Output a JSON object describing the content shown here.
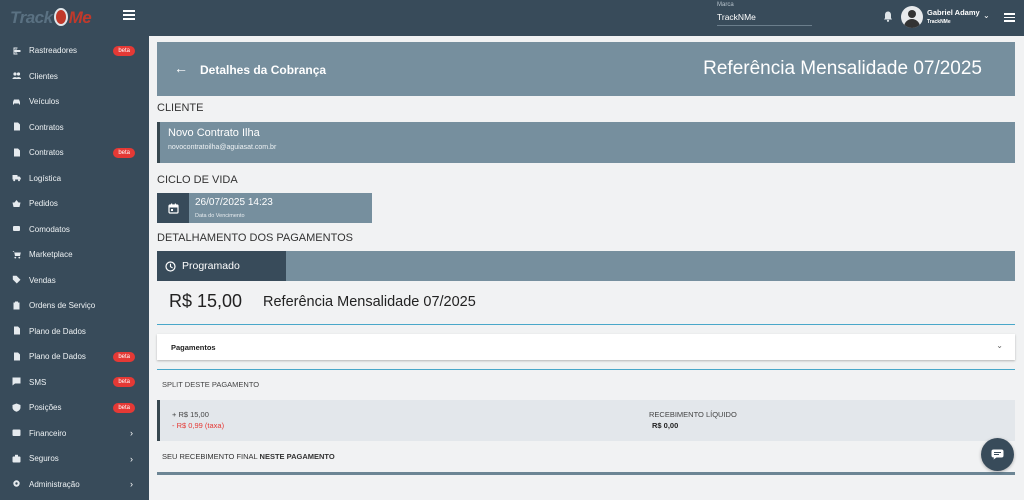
{
  "logo": {
    "text_left": "Track",
    "text_right": "Me"
  },
  "sidebar": {
    "items": [
      {
        "label": "Rastreadores",
        "icon": "login-icon",
        "beta": "beta",
        "chevron": ""
      },
      {
        "label": "Clientes",
        "icon": "people-icon",
        "beta": "",
        "chevron": ""
      },
      {
        "label": "Veículos",
        "icon": "car-icon",
        "beta": "",
        "chevron": ""
      },
      {
        "label": "Contratos",
        "icon": "document-icon",
        "beta": "",
        "chevron": ""
      },
      {
        "label": "Contratos",
        "icon": "document-icon",
        "beta": "beta",
        "chevron": ""
      },
      {
        "label": "Logística",
        "icon": "truck-icon",
        "beta": "",
        "chevron": ""
      },
      {
        "label": "Pedidos",
        "icon": "basket-icon",
        "beta": "",
        "chevron": ""
      },
      {
        "label": "Comodatos",
        "icon": "hardware-icon",
        "beta": "",
        "chevron": ""
      },
      {
        "label": "Marketplace",
        "icon": "cart-icon",
        "beta": "",
        "chevron": ""
      },
      {
        "label": "Vendas",
        "icon": "tag-icon",
        "beta": "",
        "chevron": ""
      },
      {
        "label": "Ordens de Serviço",
        "icon": "clipboard-icon",
        "beta": "",
        "chevron": ""
      },
      {
        "label": "Plano de Dados",
        "icon": "sim-card-icon",
        "beta": "",
        "chevron": ""
      },
      {
        "label": "Plano de Dados",
        "icon": "sim-card-icon",
        "beta": "beta",
        "chevron": ""
      },
      {
        "label": "SMS",
        "icon": "message-icon",
        "beta": "beta",
        "chevron": ""
      },
      {
        "label": "Posições",
        "icon": "shield-icon",
        "beta": "beta",
        "chevron": ""
      },
      {
        "label": "Financeiro",
        "icon": "wallet-icon",
        "beta": "",
        "chevron": "›"
      },
      {
        "label": "Seguros",
        "icon": "briefcase-icon",
        "beta": "",
        "chevron": "›"
      },
      {
        "label": "Administração",
        "icon": "gear-icon",
        "beta": "",
        "chevron": "›"
      }
    ]
  },
  "topbar": {
    "brand_label": "Marca",
    "brand_value": "TrackNMe",
    "user_name": "Gabriel Adamy",
    "user_company": "TrackNMe"
  },
  "header": {
    "title": "Detalhes da Cobrança",
    "reference": "Referência  Mensalidade 07/2025"
  },
  "client": {
    "section_title": "CLIENTE",
    "name": "Novo Contrato Ilha",
    "email": "novocontratoilha@aguiasat.com.br"
  },
  "lifecycle": {
    "section_title": "CICLO DE VIDA",
    "date": "26/07/2025 14:23",
    "date_label": "Data do Vencimento"
  },
  "payments_detail": {
    "section_title": "DETALHAMENTO DOS PAGAMENTOS",
    "status": "Programado",
    "amount": "R$ 15,00",
    "reference": "Referência  Mensalidade 07/2025",
    "panel_title": "Pagamentos"
  },
  "split": {
    "title": "SPLIT DESTE PAGAMENTO",
    "gross": "+ R$ 15,00",
    "fee": "- R$ 0,99 (taxa)",
    "net_label": "RECEBIMENTO LÍQUIDO",
    "net_value": "R$ 0,00",
    "final_text": "SEU RECEBIMENTO FINAL ",
    "final_bold": "NESTE PAGAMENTO"
  },
  "colors": {
    "sidebar": "#384b5a",
    "card": "#768f9e",
    "accent_line": "#49a7c9",
    "beta": "#e53935"
  }
}
